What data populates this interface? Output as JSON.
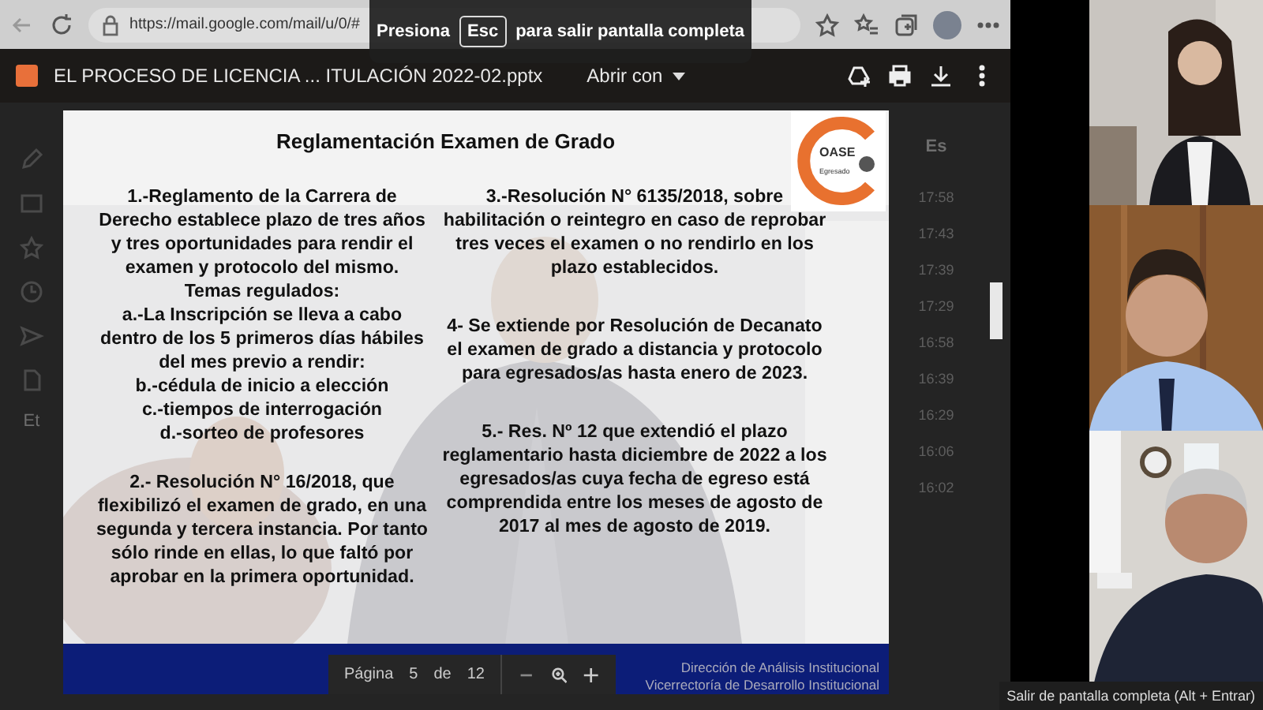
{
  "browser": {
    "url": "https://mail.google.com/mail/u/0/#"
  },
  "fullscreen_notice": {
    "before": "Presiona",
    "key": "Esc",
    "after": "para salir pantalla completa"
  },
  "viewer": {
    "file_title": "EL PROCESO DE LICENCIA ... ITULACIÓN 2022-02.pptx",
    "open_with": "Abrir con"
  },
  "slide": {
    "title": "Reglamentación Examen de Grado",
    "logo": {
      "name": "OASE",
      "subtitle": "Egresado"
    },
    "columns": [
      [
        [
          "1.-Reglamento de la Carrera de Derecho establece plazo de tres años y tres oportunidades para rendir el examen y protocolo del mismo.",
          "Temas regulados:",
          "a.-La Inscripción se lleva a cabo dentro de los 5 primeros días hábiles del mes previo a rendir:",
          "b.-cédula de inicio a elección",
          "c.-tiempos de interrogación",
          "d.-sorteo de profesores"
        ],
        [
          "2.- Resolución N° 16/2018,  que flexibilizó el examen de grado, en una segunda  y tercera instancia. Por tanto sólo rinde en ellas, lo que faltó por aprobar  en la primera oportunidad."
        ]
      ],
      [
        [
          "3.-Resolución N° 6135/2018, sobre habilitación o reintegro en caso de reprobar tres veces el examen o no rendirlo en los plazo establecidos."
        ],
        [
          "4- Se extiende por Resolución de Decanato el  examen de grado a distancia y protocolo  para egresados/as hasta enero de 2023."
        ],
        [
          "5.- Res. Nº 12 que extendió el plazo reglamentario  hasta diciembre de 2022 a los egresados/as cuya fecha de egreso está comprendida entre los meses de agosto de 2017 al mes de agosto de 2019."
        ]
      ]
    ]
  },
  "page_controls": {
    "label": "Página",
    "page": "5",
    "separator": "de",
    "total": "12"
  },
  "footer_lines": [
    "Dirección de Análisis Institucional",
    "Vicerrectoría de Desarrollo Institucional"
  ],
  "mail_background": {
    "sidebar_label": "Et",
    "column_header": "Es",
    "times": [
      "17:58",
      "17:43",
      "17:39",
      "17:29",
      "16:58",
      "16:39",
      "16:29",
      "16:06",
      "16:02"
    ]
  },
  "tooltip": "Salir de pantalla completa (Alt + Entrar)"
}
